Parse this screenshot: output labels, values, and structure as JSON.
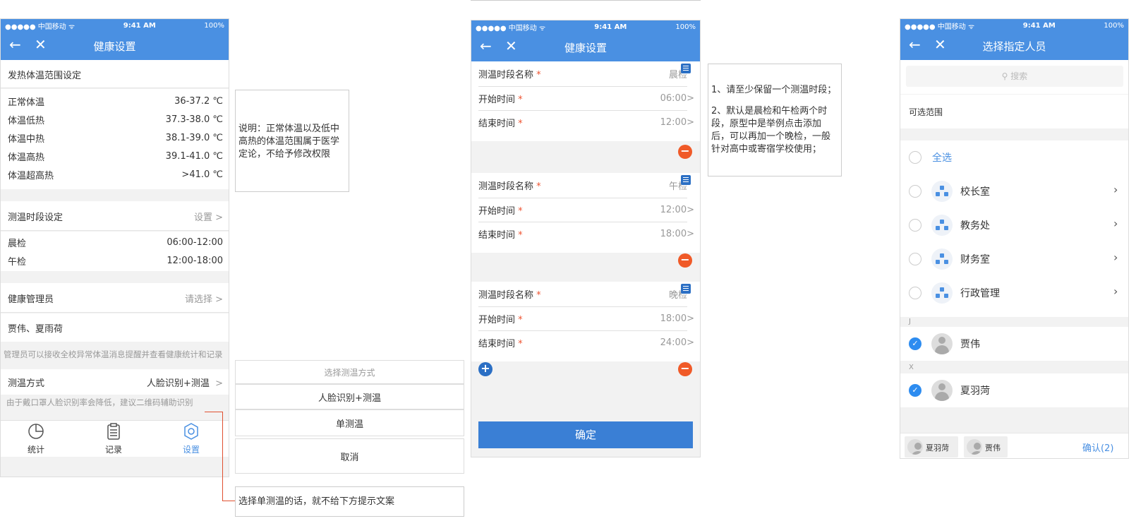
{
  "status": {
    "carrier": "●●●●● 中国移动 ᯤ",
    "time": "9:41 AM",
    "battery": "100%"
  },
  "screen1": {
    "title": "健康设置",
    "fever_header": "发热体温范围设定",
    "fever_rows": [
      {
        "label": "正常体温",
        "value": "36-37.2 ℃"
      },
      {
        "label": "体温低热",
        "value": "37.3-38.0 ℃"
      },
      {
        "label": "体温中热",
        "value": "38.1-39.0 ℃"
      },
      {
        "label": "体温高热",
        "value": "39.1-41.0 ℃"
      },
      {
        "label": "体温超高热",
        "value": ">41.0 ℃"
      }
    ],
    "period_header": "测温时段设定",
    "period_action": "设置 >",
    "period_rows": [
      {
        "label": "晨检",
        "value": "06:00-12:00"
      },
      {
        "label": "午检",
        "value": "12:00-18:00"
      }
    ],
    "admin_label": "健康管理员",
    "admin_action": "请选择 >",
    "admin_names": "贾伟、夏雨荷",
    "admin_hint": "管理员可以接收全校异常体温消息提醒并查看健康统计和记录",
    "method_label": "测温方式",
    "method_value": "人脸识别+测温",
    "method_arrow": ">",
    "method_hint": "由于戴口罩人脸识别率会降低，建议二维码辅助识别",
    "tabs": [
      {
        "label": "统计"
      },
      {
        "label": "记录"
      },
      {
        "label": "设置"
      }
    ]
  },
  "note1": "说明：正常体温以及低中高热的体温范围属于医学定论，不给予修改权限",
  "sheet": {
    "title": "选择测温方式",
    "options": [
      "人脸识别+测温",
      "单测温"
    ],
    "cancel": "取消"
  },
  "note_bottom": "选择单测温的话，就不给下方提示文案",
  "screen2": {
    "title": "健康设置",
    "name_label": "测温时段名称",
    "start_label": "开始时间",
    "end_label": "结束时间",
    "star": "*",
    "blocks": [
      {
        "name": "晨检",
        "start": "06:00",
        "end": "12:00"
      },
      {
        "name": "午检",
        "start": "12:00",
        "end": "18:00"
      },
      {
        "name": "晚检",
        "start": "18:00",
        "end": "24:00"
      }
    ],
    "confirm": "确定"
  },
  "note2": {
    "line1": "1、请至少保留一个测温时段；",
    "line2": "2、默认是晨检和午检两个时段，原型中是举例点击添加后，可以再加一个晚检，一般针对高中或寄宿学校使用；"
  },
  "screen3": {
    "title": "选择指定人员",
    "search_placeholder": "搜索",
    "range_label": "可选范围",
    "select_all": "全选",
    "departments": [
      "校长室",
      "教务处",
      "财务室",
      "行政管理"
    ],
    "group_j": "J",
    "person_j": "贾伟",
    "group_x": "X",
    "person_x": "夏羽菏",
    "chips": [
      "夏羽菏",
      "贾伟"
    ],
    "confirm": "确认(2)"
  },
  "colors": {
    "primary": "#4a90e2",
    "danger": "#f05a28",
    "check": "#2d8cf0"
  }
}
